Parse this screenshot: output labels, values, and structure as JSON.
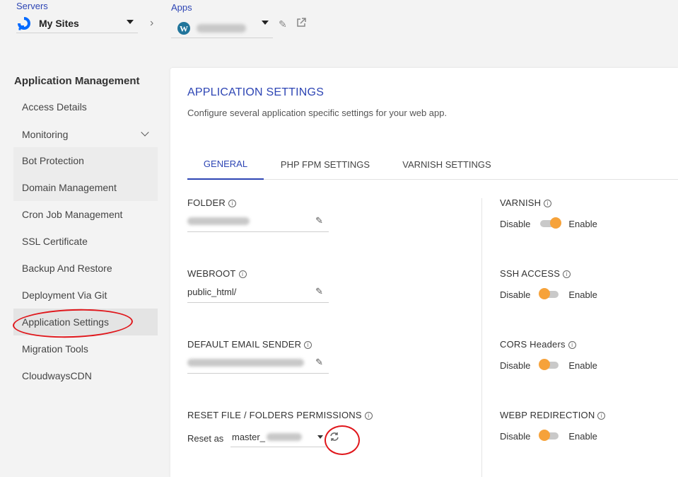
{
  "breadcrumb": {
    "servers_label": "Servers",
    "server_name": "My Sites",
    "apps_label": "Apps"
  },
  "sidebar": {
    "title": "Application Management",
    "items": [
      {
        "label": "Access Details"
      },
      {
        "label": "Monitoring"
      },
      {
        "label": "Bot Protection"
      },
      {
        "label": "Domain Management"
      },
      {
        "label": "Cron Job Management"
      },
      {
        "label": "SSL Certificate"
      },
      {
        "label": "Backup And Restore"
      },
      {
        "label": "Deployment Via Git"
      },
      {
        "label": "Application Settings"
      },
      {
        "label": "Migration Tools"
      },
      {
        "label": "CloudwaysCDN"
      }
    ],
    "active": "Application Settings"
  },
  "main": {
    "title": "APPLICATION SETTINGS",
    "subtitle": "Configure several application specific settings for your web app.",
    "tabs": [
      {
        "label": "GENERAL"
      },
      {
        "label": "PHP FPM SETTINGS"
      },
      {
        "label": "VARNISH SETTINGS"
      }
    ],
    "active_tab": "GENERAL",
    "fields": {
      "folder_label": "FOLDER",
      "webroot_label": "WEBROOT",
      "webroot_value": "public_html/",
      "email_label": "DEFAULT EMAIL SENDER",
      "reset_label": "RESET FILE / FOLDERS PERMISSIONS",
      "reset_as": "Reset as",
      "reset_user": "master_"
    },
    "toggles": [
      {
        "label": "VARNISH",
        "state": "on"
      },
      {
        "label": "SSH ACCESS",
        "state": "off"
      },
      {
        "label": "CORS Headers",
        "state": "off"
      },
      {
        "label": "WEBP REDIRECTION",
        "state": "off"
      }
    ],
    "disable_text": "Disable",
    "enable_text": "Enable"
  },
  "colors": {
    "accent": "#2d45b4",
    "toggle_knob": "#f6a23a",
    "annotation": "#e0161b"
  }
}
